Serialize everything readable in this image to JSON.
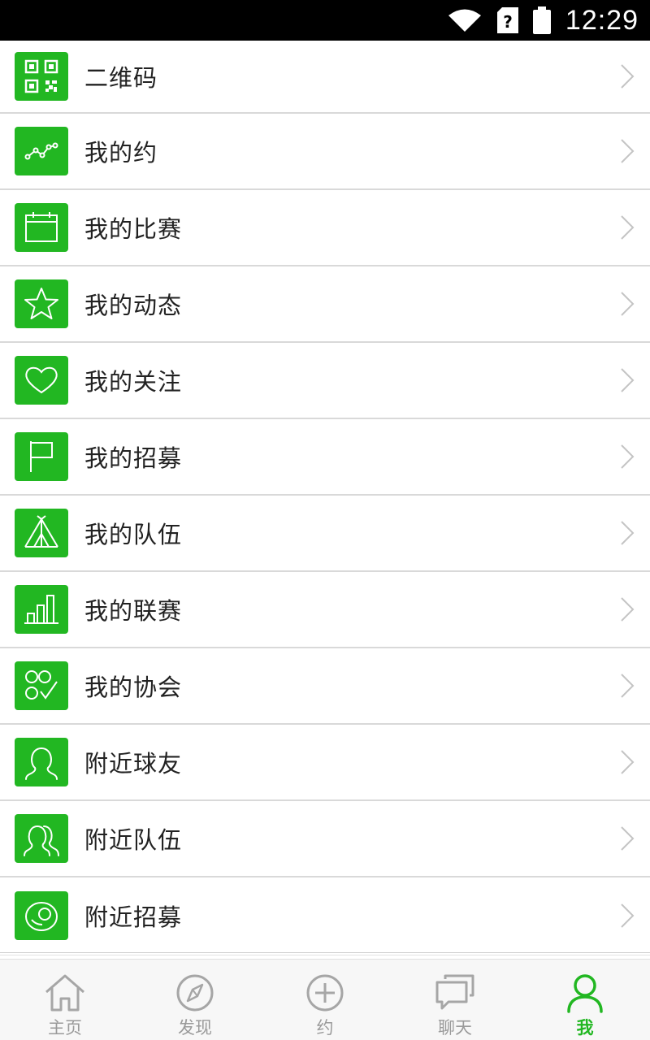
{
  "status_bar": {
    "time": "12:29",
    "icons": [
      "wifi-icon",
      "sim-unknown-icon",
      "battery-icon"
    ]
  },
  "menu": {
    "items": [
      {
        "label": "二维码",
        "icon": "qr-code-icon"
      },
      {
        "label": "我的约",
        "icon": "trend-line-icon"
      },
      {
        "label": "我的比赛",
        "icon": "calendar-icon"
      },
      {
        "label": "我的动态",
        "icon": "star-icon"
      },
      {
        "label": "我的关注",
        "icon": "heart-icon"
      },
      {
        "label": "我的招募",
        "icon": "flag-icon"
      },
      {
        "label": "我的队伍",
        "icon": "tent-icon"
      },
      {
        "label": "我的联赛",
        "icon": "bar-chart-icon"
      },
      {
        "label": "我的协会",
        "icon": "group-check-icon"
      },
      {
        "label": "附近球友",
        "icon": "person-icon"
      },
      {
        "label": "附近队伍",
        "icon": "people-icon"
      },
      {
        "label": "附近招募",
        "icon": "target-icon"
      }
    ]
  },
  "tab_bar": {
    "tabs": [
      {
        "label": "主页",
        "icon": "home-icon"
      },
      {
        "label": "发现",
        "icon": "compass-icon"
      },
      {
        "label": "约",
        "icon": "plus-circle-icon"
      },
      {
        "label": "聊天",
        "icon": "chat-icon"
      },
      {
        "label": "我",
        "icon": "user-icon",
        "active": true
      }
    ]
  },
  "colors": {
    "accent": "#22b722",
    "inactive_tab": "#9a9a9a",
    "divider": "#d9d9d9",
    "status_bar_bg": "#000000"
  }
}
